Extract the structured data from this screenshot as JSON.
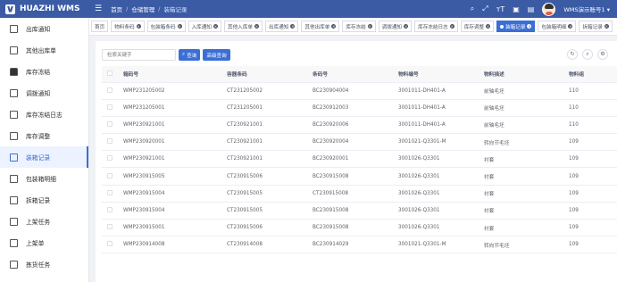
{
  "app": {
    "title": "HUAZHI WMS"
  },
  "breadcrumb": [
    "首页",
    "仓储管理",
    "装箱记录"
  ],
  "user": {
    "name": "WMS演示账号1"
  },
  "sidebar": {
    "items": [
      {
        "label": "出库通知",
        "icon": "bell-outline-icon"
      },
      {
        "label": "其他出库单",
        "icon": "inbox-out-icon"
      },
      {
        "label": "库存冻结",
        "icon": "lock-icon"
      },
      {
        "label": "调拨通知",
        "icon": "transfer-doc-icon"
      },
      {
        "label": "库存冻结日志",
        "icon": "log-doc-icon"
      },
      {
        "label": "库存调整",
        "icon": "adjust-chart-icon"
      },
      {
        "label": "装箱记录",
        "icon": "box-packing-icon",
        "active": true
      },
      {
        "label": "包装箱明细",
        "icon": "box-detail-icon"
      },
      {
        "label": "拆箱记录",
        "icon": "unbox-icon"
      },
      {
        "label": "上架任务",
        "icon": "shelf-task-icon"
      },
      {
        "label": "上架单",
        "icon": "shelf-doc-icon"
      },
      {
        "label": "拣货任务",
        "icon": "picking-icon"
      }
    ]
  },
  "tabs": [
    {
      "label": "首页",
      "closable": false
    },
    {
      "label": "物料条码",
      "closable": true
    },
    {
      "label": "包装箱条码",
      "closable": true
    },
    {
      "label": "入库通知",
      "closable": true
    },
    {
      "label": "其他入库单",
      "closable": true
    },
    {
      "label": "出库通知",
      "closable": true
    },
    {
      "label": "其他出库单",
      "closable": true
    },
    {
      "label": "库存冻结",
      "closable": true
    },
    {
      "label": "调拨通知",
      "closable": true
    },
    {
      "label": "库存冻结日志",
      "closable": true
    },
    {
      "label": "库存调整",
      "closable": true
    },
    {
      "label": "装箱记录",
      "closable": true,
      "active": true
    },
    {
      "label": "包装箱明细",
      "closable": true
    },
    {
      "label": "拆箱记录",
      "closable": true
    }
  ],
  "search": {
    "placeholder": "检索关键字",
    "query_label": "查询",
    "advanced_label": "高级查询"
  },
  "table": {
    "columns": [
      "箱码号",
      "容器条码",
      "条码号",
      "物料编号",
      "物料描述",
      "物料组"
    ],
    "rows": [
      [
        "WMP231205002",
        "CT231205002",
        "BC230904004",
        "3001011-DH401-A",
        "前轴毛坯",
        "110"
      ],
      [
        "WMP231205001",
        "CT231205001",
        "BC230912003",
        "3001011-DH401-A",
        "前轴毛坯",
        "110"
      ],
      [
        "WMP230921001",
        "CT230921001",
        "BC230920006",
        "3001011-DH401-A",
        "前轴毛坯",
        "110"
      ],
      [
        "WMP230920001",
        "CT230921001",
        "BC230920004",
        "3001021-Q3301-M",
        "转向节毛坯",
        "109"
      ],
      [
        "WMP230921001",
        "CT230921001",
        "BC230920001",
        "3001026-Q3301",
        "衬套",
        "109"
      ],
      [
        "WMP230915005",
        "CT230915006",
        "BC230915008",
        "3001026-Q3301",
        "衬套",
        "109"
      ],
      [
        "WMP230915004",
        "CT230915005",
        "CT230915008",
        "3001026-Q3301",
        "衬套",
        "109"
      ],
      [
        "WMP230915004",
        "CT230915005",
        "BC230915008",
        "3001026-Q3301",
        "衬套",
        "109"
      ],
      [
        "WMP230915001",
        "CT230915006",
        "BC230915008",
        "3001026-Q3301",
        "衬套",
        "109"
      ],
      [
        "WMP230914008",
        "CT230914008",
        "BC230914029",
        "3001021-Q3301-M",
        "转向节毛坯",
        "109"
      ]
    ]
  },
  "colors": {
    "header_bg": "#3b5ba5",
    "accent": "#3b6fd4"
  }
}
